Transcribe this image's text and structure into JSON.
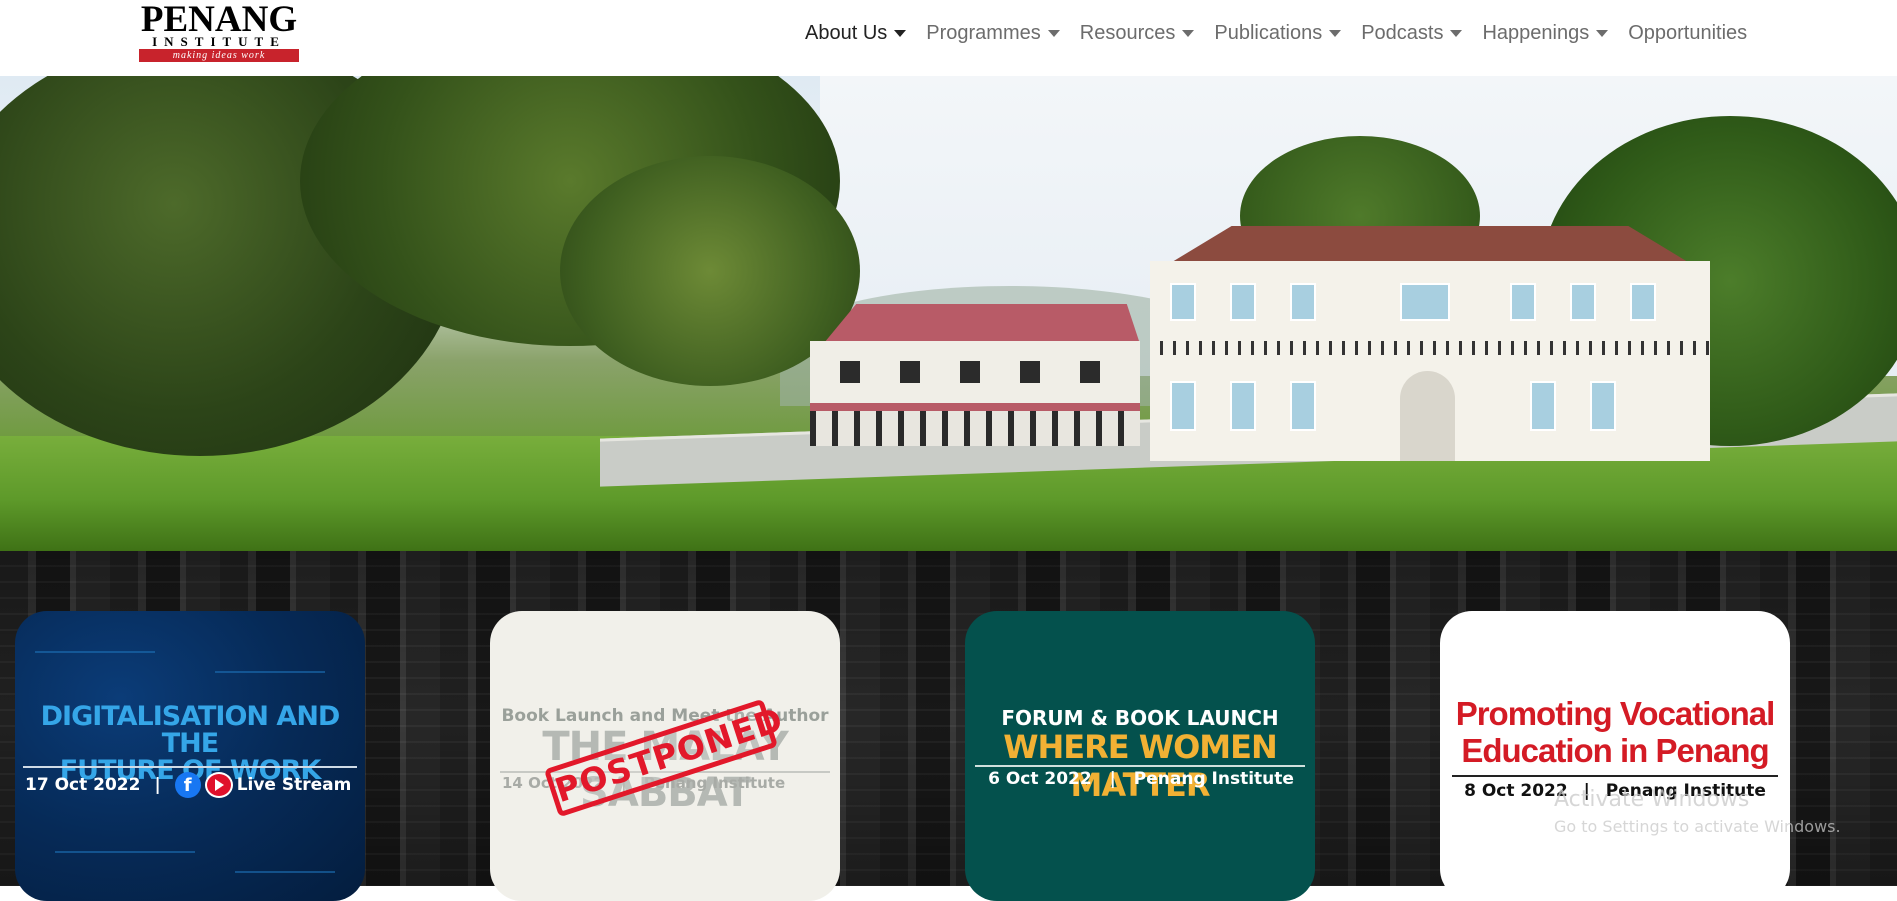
{
  "logo": {
    "main": "PENANG",
    "sub": "INSTITUTE",
    "tagline": "making ideas work"
  },
  "nav": {
    "items": [
      {
        "label": "About Us",
        "dropdown": true,
        "active": true
      },
      {
        "label": "Programmes",
        "dropdown": true
      },
      {
        "label": "Resources",
        "dropdown": true
      },
      {
        "label": "Publications",
        "dropdown": true
      },
      {
        "label": "Podcasts",
        "dropdown": true
      },
      {
        "label": "Happenings",
        "dropdown": true
      },
      {
        "label": "Opportunities",
        "dropdown": false
      }
    ]
  },
  "hero": {
    "image": "penang-institute-building-photo"
  },
  "events": [
    {
      "title_line1": "DIGITALISATION AND THE",
      "title_line2": "FUTURE OF WORK",
      "date": "17 Oct 2022",
      "separator": "|",
      "venue": "Live Stream",
      "bg_color": "#062a57"
    },
    {
      "subtitle": "Book Launch and Meet the Author",
      "title": "THE MALAY SABBAT",
      "date": "14 Oct 2022",
      "separator": "|",
      "venue": "Penang Institute",
      "stamp": "POSTPONED",
      "bg_color": "#f1f0ea"
    },
    {
      "subtitle": "FORUM & BOOK LAUNCH",
      "title": "WHERE WOMEN MATTER",
      "date": "6 Oct 2022",
      "separator": "|",
      "venue": "Penang Institute",
      "bg_color": "#04514d"
    },
    {
      "title_line1": "Promoting Vocational",
      "title_line2": "Education in Penang",
      "date": "8 Oct 2022",
      "separator": "|",
      "venue": "Penang Institute",
      "bg_color": "#ffffff"
    }
  ],
  "watermark": {
    "title": "Activate Windows",
    "subtitle": "Go to Settings to activate Windows."
  }
}
